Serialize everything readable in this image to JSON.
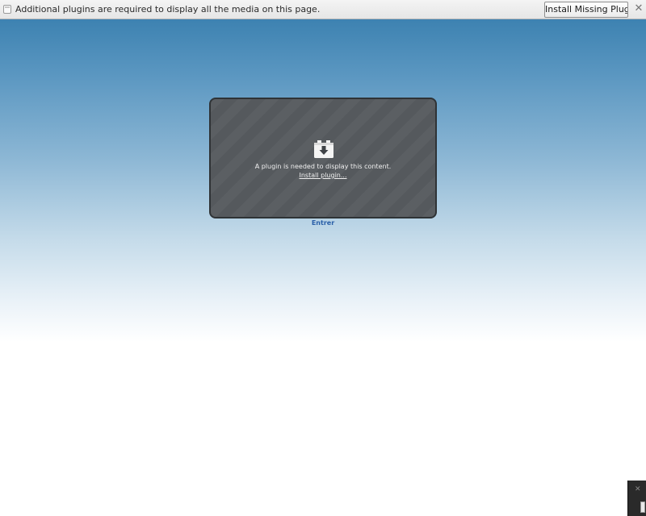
{
  "notification": {
    "icon": "plugin-page-icon",
    "message": "Additional plugins are required to display all the media on this page.",
    "install_button_label": "Install Missing Plugins...",
    "close_glyph": "✕"
  },
  "plugin_placeholder": {
    "icon": "download-arrow-icon",
    "message": "A plugin is needed to display this content.",
    "install_link": "Install plugin..."
  },
  "page": {
    "entrer_link": "Entrer"
  },
  "corner_widget": {
    "close_glyph": "✕"
  },
  "colors": {
    "background_top": "#3d82b1",
    "background_bottom": "#ffffff",
    "plugin_box": "#55595d",
    "link_blue": "#2a5fa8"
  }
}
